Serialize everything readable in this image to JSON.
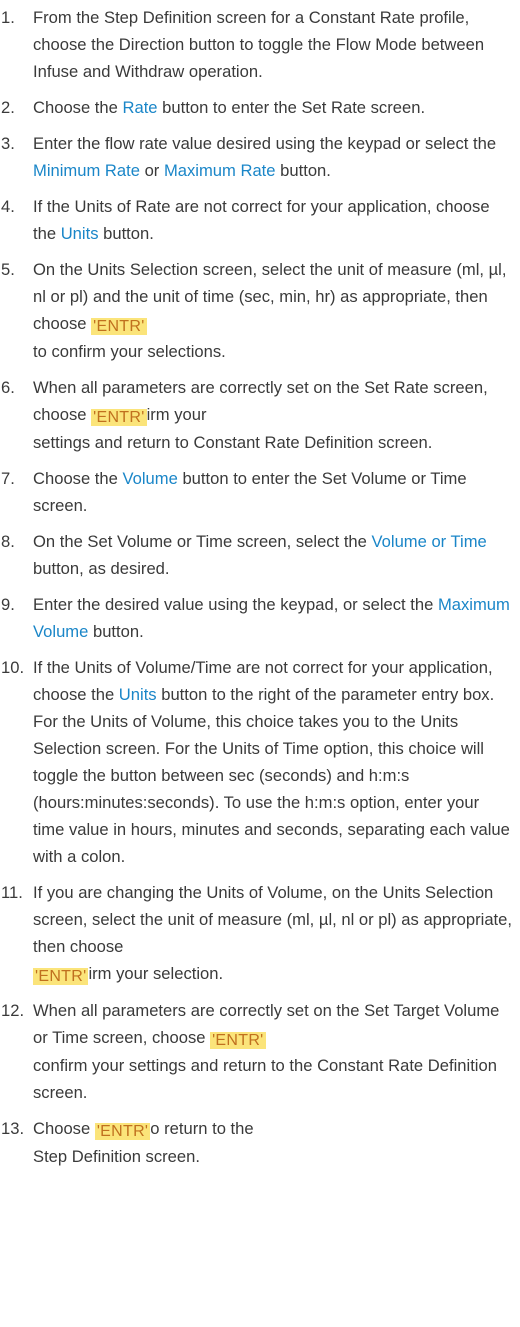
{
  "steps": [
    {
      "num": "1.",
      "parts": [
        {
          "t": "From the Step Definition screen for a Constant Rate profile, choose the Direction button to toggle the Flow Mode between Infuse and Withdraw operation."
        }
      ]
    },
    {
      "num": "2.",
      "parts": [
        {
          "t": "Choose the "
        },
        {
          "t": "Rate",
          "k": "link"
        },
        {
          "t": " button to enter the Set Rate screen."
        }
      ]
    },
    {
      "num": "3.",
      "parts": [
        {
          "t": "Enter the flow rate value desired using the keypad or select the "
        },
        {
          "t": "Minimum Rate",
          "k": "link"
        },
        {
          "t": " or "
        },
        {
          "t": "Maximum Rate",
          "k": "link"
        },
        {
          "t": " button."
        }
      ]
    },
    {
      "num": "4.",
      "parts": [
        {
          "t": "If the Units of Rate are not correct for your application, choose the "
        },
        {
          "t": "Units",
          "k": "link"
        },
        {
          "t": " button."
        }
      ]
    },
    {
      "num": "5.",
      "parts": [
        {
          "t": "On the Units Selection screen, select the unit of measure (ml, µl, nl or pl) and the unit of time (sec, min, hr) as appropriate, then choose "
        },
        {
          "t": "'ENTR'",
          "k": "hl"
        },
        {
          "t": "\nto confirm your selections."
        }
      ]
    },
    {
      "num": "6.",
      "parts": [
        {
          "t": "When all parameters are correctly set on the Set Rate screen, choose "
        },
        {
          "t": "'ENTR'",
          "k": "hl"
        },
        {
          "t": "irm your\nsettings and return to Constant Rate Definition screen."
        }
      ]
    },
    {
      "num": "7.",
      "parts": [
        {
          "t": "Choose the "
        },
        {
          "t": "Volume",
          "k": "link"
        },
        {
          "t": " button to enter the Set Volume or Time screen."
        }
      ]
    },
    {
      "num": "8.",
      "parts": [
        {
          "t": "On the Set Volume or Time screen, select the "
        },
        {
          "t": "Volume or Time",
          "k": "link"
        },
        {
          "t": " button, as desired."
        }
      ]
    },
    {
      "num": "9.",
      "parts": [
        {
          "t": "Enter the desired value using the keypad, or select the "
        },
        {
          "t": "Maximum Volume",
          "k": "link"
        },
        {
          "t": " button."
        }
      ]
    },
    {
      "num": "10.",
      "parts": [
        {
          "t": "If the Units of Volume/Time are not correct for your application, choose the "
        },
        {
          "t": "Units",
          "k": "link"
        },
        {
          "t": " button to the right of the parameter entry box. For the Units of Volume, this choice takes you to the Units Selection screen. For the Units of Time option, this choice will toggle the button between sec (seconds) and h:m:s (hours:minutes:seconds). To use the h:m:s option, enter your time value in hours, minutes and seconds, separating each value with a colon."
        }
      ]
    },
    {
      "num": "11.",
      "parts": [
        {
          "t": "If you are changing the Units of Volume, on the Units Selection screen, select the unit of measure (ml, µl, nl or pl) as appropriate, then choose\n"
        },
        {
          "t": "'ENTR'",
          "k": "hl"
        },
        {
          "t": "irm your selection."
        }
      ]
    },
    {
      "num": "12.",
      "parts": [
        {
          "t": "When all parameters are correctly set on the Set Target Volume or Time screen, choose "
        },
        {
          "t": "'ENTR'",
          "k": "hl"
        },
        {
          "t": "\nconfirm your settings and return to the Constant Rate Definition screen."
        }
      ]
    },
    {
      "num": "13.",
      "parts": [
        {
          "t": "Choose "
        },
        {
          "t": "'ENTR'",
          "k": "hl"
        },
        {
          "t": "o return to the\nStep Definition screen."
        }
      ]
    }
  ]
}
